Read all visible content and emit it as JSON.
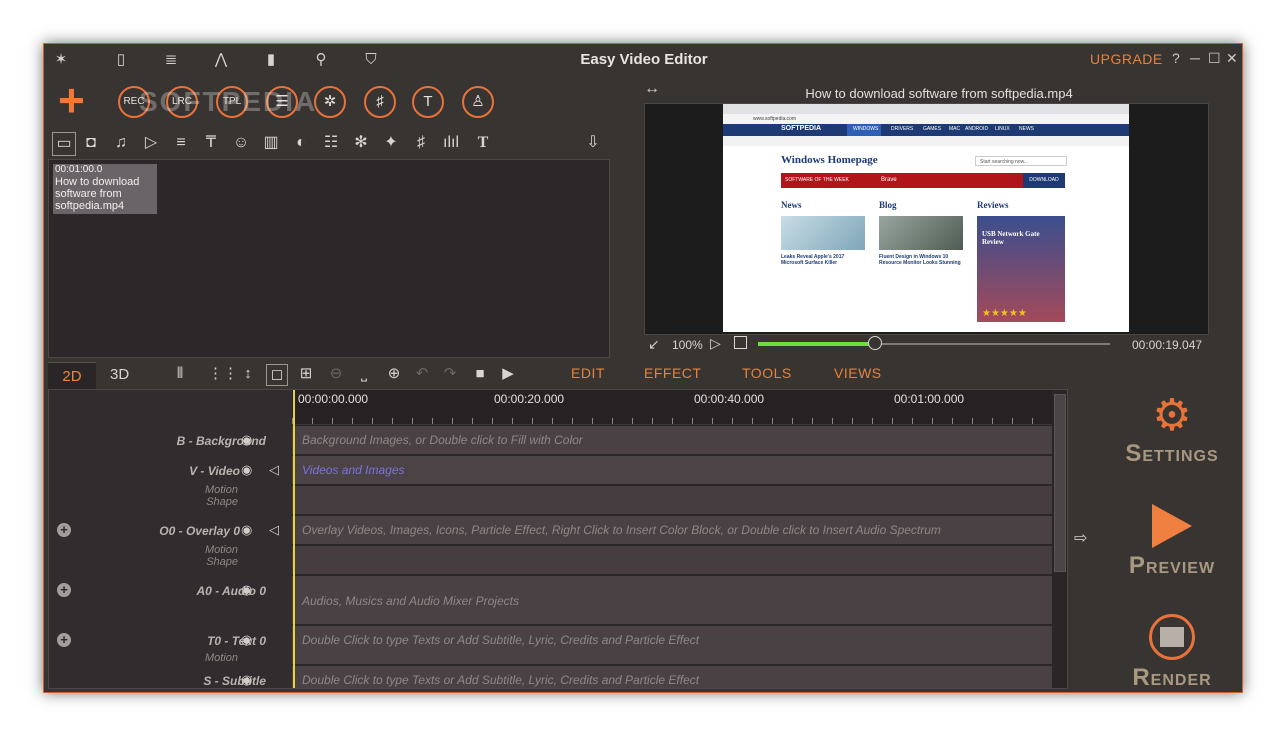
{
  "window": {
    "title": "Easy Video Editor",
    "upgrade_label": "UPGRADE",
    "help": "?"
  },
  "top_tools": {
    "rec": "REC",
    "lrc": "LRC",
    "tpl": "TPL",
    "watermark": "SOFTPEDIA"
  },
  "media": {
    "clip_time": "00:01:00.0",
    "clip_name": "How to download software from softpedia.mp4"
  },
  "preview": {
    "title": "How to download software from softpedia.mp4",
    "zoom": "100%",
    "time": "00:00:19.047",
    "progress": 0.33
  },
  "lower_tabs": {
    "tab_2d": "2D",
    "tab_3d": "3D"
  },
  "menus": {
    "edit": "EDIT",
    "effect": "EFFECT",
    "tools": "TOOLS",
    "views": "VIEWS"
  },
  "ruler": [
    "00:00:00.000",
    "00:00:20.000",
    "00:00:40.000",
    "00:01:00.000"
  ],
  "tracks": {
    "background": {
      "label": "B - Background",
      "hint": "Background Images, or Double click to Fill with Color"
    },
    "video": {
      "label": "V - Video",
      "sub1": "Motion",
      "sub2": "Shape",
      "hint": "Videos and Images"
    },
    "overlay": {
      "label": "O0 - Overlay 0",
      "sub1": "Motion",
      "sub2": "Shape",
      "hint": "Overlay Videos, Images, Icons, Particle Effect, Right Click to Insert Color Block, or Double click to Insert Audio Spectrum"
    },
    "audio": {
      "label": "A0 - Audio 0",
      "hint": "Audios, Musics and Audio Mixer Projects"
    },
    "text": {
      "label": "T0 - Text 0",
      "sub1": "Motion",
      "hint": "Double Click to type Texts or Add Subtitle, Lyric, Credits and Particle Effect"
    },
    "subtitle": {
      "label": "S - Subtitle",
      "hint": "Double Click to type Texts or Add Subtitle, Lyric, Credits and Particle Effect"
    }
  },
  "right_panel": {
    "settings": {
      "cap": "S",
      "rest": "ETTINGS"
    },
    "preview": {
      "cap": "P",
      "rest": "REVIEW"
    },
    "render": {
      "cap": "R",
      "rest": "ENDER"
    }
  },
  "browser": {
    "url": "www.softpedia.com",
    "logo": "SOFTPEDIA",
    "nav": [
      "WINDOWS",
      "DRIVERS",
      "GAMES",
      "MAC",
      "ANDROID",
      "LINUX",
      "NEWS"
    ],
    "heading": "Windows Homepage",
    "search": "Start searching now...",
    "week": "SOFTWARE OF THE WEEK",
    "featured": "Brave",
    "download": "DOWNLOAD",
    "cols": [
      "News",
      "Blog",
      "Reviews"
    ],
    "review_title": "USB Network Gate Review",
    "news_title": "Leaks Reveal Apple's 2017 Microsoft Surface Killer",
    "blog_title": "Fluent Design in Windows 10 Resource Monitor Looks Stunning"
  }
}
